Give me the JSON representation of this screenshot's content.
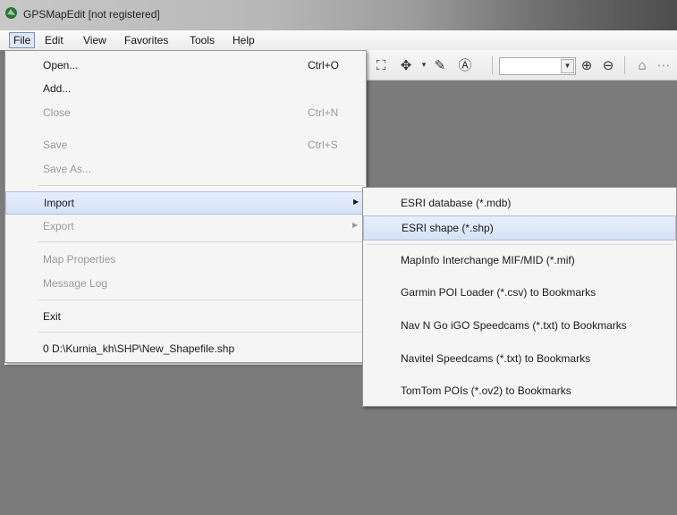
{
  "window": {
    "title": "GPSMapEdit [not registered]"
  },
  "menubar": {
    "items": [
      "File",
      "Edit",
      "View",
      "Favorites",
      "Tools",
      "Help"
    ]
  },
  "file_menu": {
    "open": {
      "label": "Open...",
      "shortcut": "Ctrl+O"
    },
    "add": {
      "label": "Add..."
    },
    "close": {
      "label": "Close",
      "shortcut": "Ctrl+N"
    },
    "save": {
      "label": "Save",
      "shortcut": "Ctrl+S"
    },
    "save_as": {
      "label": "Save As..."
    },
    "import": {
      "label": "Import"
    },
    "export": {
      "label": "Export"
    },
    "map_properties": {
      "label": "Map Properties"
    },
    "message_log": {
      "label": "Message Log"
    },
    "exit": {
      "label": "Exit"
    },
    "recent_file": {
      "label": "0 D:\\Kurnia_kh\\SHP\\New_Shapefile.shp"
    }
  },
  "import_submenu": {
    "items": [
      "ESRI database (*.mdb)",
      "ESRI shape (*.shp)",
      "MapInfo Interchange MIF/MID (*.mif)",
      "Garmin POI Loader (*.csv) to Bookmarks",
      "Nav N Go iGO Speedcams (*.txt) to Bookmarks",
      "Navitel Speedcams (*.txt) to Bookmarks",
      "TomTom POIs (*.ov2) to Bookmarks"
    ],
    "highlighted": "ESRI shape (*.shp)"
  },
  "toolbar": {
    "icons": [
      "select-tool-icon",
      "pan-tool-icon",
      "dropdown-arrow-icon",
      "edit-node-icon",
      "label-tool-icon",
      "zoom-in-icon",
      "zoom-out-icon",
      "toolbar-extra-icon"
    ],
    "zoom_value": ""
  },
  "colors": {
    "workspace": "#7b7b7b",
    "menu_bg": "#f5f5f5",
    "highlight": "#d5e2f6",
    "disabled_text": "#9a9a9a"
  }
}
